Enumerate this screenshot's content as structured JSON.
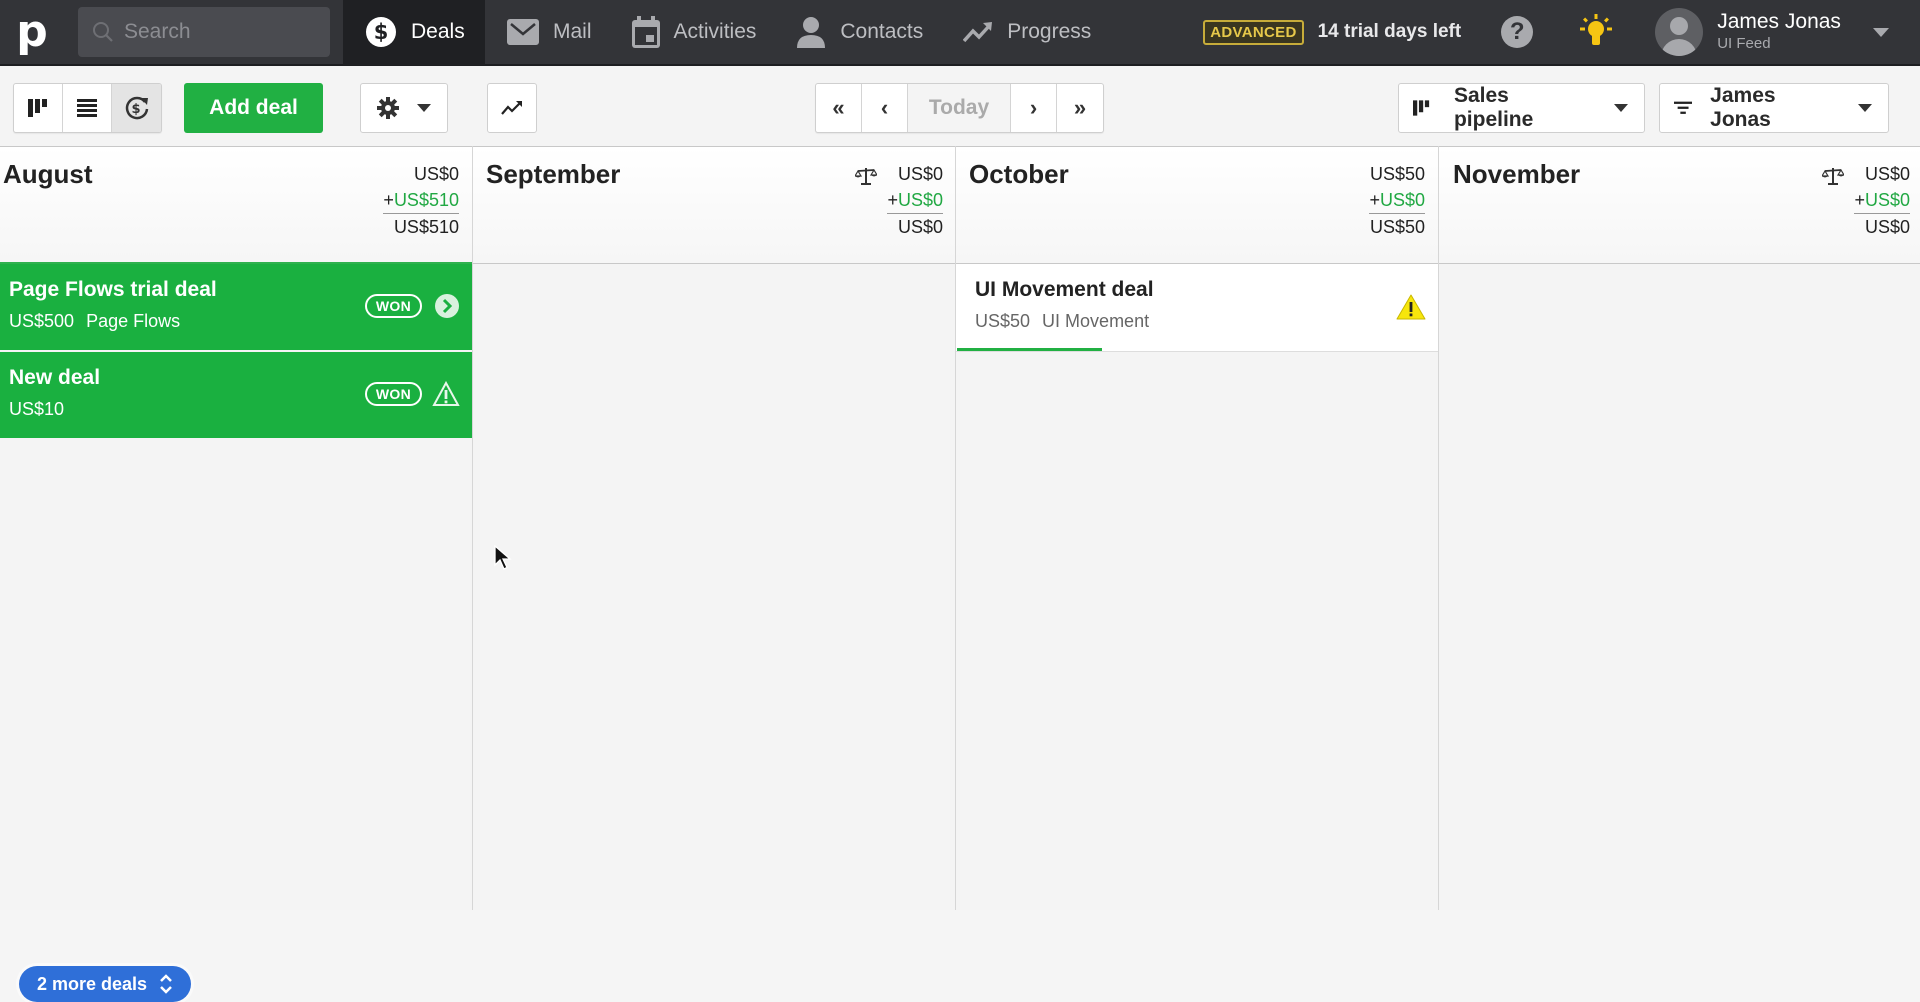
{
  "topbar": {
    "logo": "p",
    "search_placeholder": "Search",
    "nav": [
      {
        "label": "Deals",
        "icon": "dollar-circle-icon",
        "active": true
      },
      {
        "label": "Mail",
        "icon": "mail-icon",
        "active": false
      },
      {
        "label": "Activities",
        "icon": "calendar-icon",
        "active": false
      },
      {
        "label": "Contacts",
        "icon": "person-icon",
        "active": false
      },
      {
        "label": "Progress",
        "icon": "trend-up-icon",
        "active": false
      }
    ],
    "plan_badge": "ADVANCED",
    "trial_text": "14 trial days left",
    "help_label": "?",
    "user": {
      "name": "James Jonas",
      "company": "UI Feed"
    }
  },
  "toolbar": {
    "add_deal_label": "Add deal",
    "today_label": "Today",
    "prev_far_label": "«",
    "prev_label": "‹",
    "next_label": "›",
    "next_far_label": "»",
    "pipeline_label": "Sales pipeline",
    "owner_filter_label": "James Jonas"
  },
  "columns": [
    {
      "month": "August",
      "open_sum": "US$0",
      "won_prefix": "+",
      "won_sum": "US$510",
      "total": "US$510",
      "deals": [
        {
          "title": "Page Flows trial deal",
          "value": "US$500",
          "org": "Page Flows",
          "status": "WON",
          "icon": "chevron-right-circle-icon"
        },
        {
          "title": "New deal",
          "value": "US$10",
          "org": "",
          "status": "WON",
          "icon": "warning-outline-icon"
        }
      ],
      "more_deals_label": "2 more deals"
    },
    {
      "month": "September",
      "open_sum": "US$0",
      "won_prefix": "+",
      "won_sum": "US$0",
      "total": "US$0",
      "deals": []
    },
    {
      "month": "October",
      "open_sum": "US$50",
      "won_prefix": "+",
      "won_sum": "US$0",
      "total": "US$50",
      "deals": [
        {
          "title": "UI Movement deal",
          "value": "US$50",
          "org": "UI Movement",
          "status": "open",
          "icon": "warning-yellow-icon",
          "progress": 0.3
        }
      ]
    },
    {
      "month": "November",
      "open_sum": "US$0",
      "won_prefix": "+",
      "won_sum": "US$0",
      "total": "US$0",
      "deals": []
    }
  ],
  "colors": {
    "brand_green": "#21b043",
    "won_card": "#1ab040",
    "more_deals_blue": "#2f6fd8",
    "topbar": "#333438",
    "plan_badge": "#e6c84a"
  }
}
